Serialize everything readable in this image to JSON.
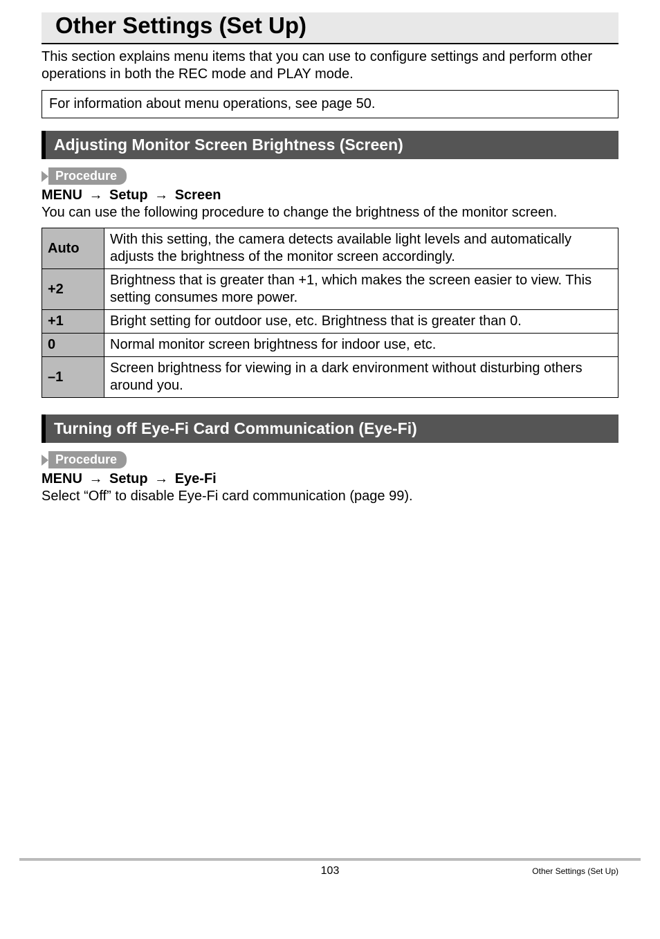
{
  "title": "Other Settings (Set Up)",
  "intro": "This section explains menu items that you can use to configure settings and perform other operations in both the REC mode and PLAY mode.",
  "info_box": "For information about menu operations, see page 50.",
  "section1": {
    "heading": "Adjusting Monitor Screen Brightness (Screen)",
    "procedure_label": "Procedure",
    "menu_path_parts": [
      "MENU",
      "Setup",
      "Screen"
    ],
    "desc": "You can use the following procedure to change the brightness of the monitor screen.",
    "rows": [
      {
        "label": "Auto",
        "text": "With this setting, the camera detects available light levels and automatically adjusts the brightness of the monitor screen accordingly."
      },
      {
        "label": "+2",
        "text": "Brightness that is greater than +1, which makes the screen easier to view. This setting consumes more power."
      },
      {
        "label": "+1",
        "text": "Bright setting for outdoor use, etc. Brightness that is greater than 0."
      },
      {
        "label": "0",
        "text": "Normal monitor screen brightness for indoor use, etc."
      },
      {
        "label": "–1",
        "text": "Screen brightness for viewing in a dark environment without disturbing others around you."
      }
    ]
  },
  "section2": {
    "heading": "Turning off Eye-Fi Card Communication (Eye-Fi)",
    "procedure_label": "Procedure",
    "menu_path_parts": [
      "MENU",
      "Setup",
      "Eye-Fi"
    ],
    "desc": "Select “Off” to disable Eye-Fi card communication (page 99)."
  },
  "footer": {
    "page": "103",
    "chapter": "Other Settings (Set Up)"
  },
  "arrow": "→"
}
